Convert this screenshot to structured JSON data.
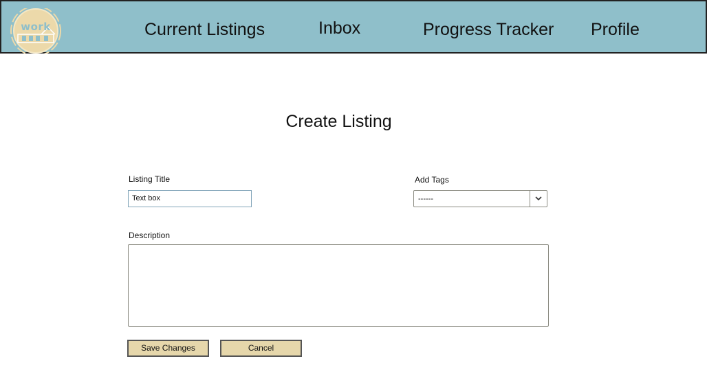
{
  "nav": {
    "logo_text": "work",
    "items": [
      {
        "label": "Current Listings"
      },
      {
        "label": "Inbox"
      },
      {
        "label": "Progress Tracker"
      },
      {
        "label": "Profile"
      }
    ]
  },
  "page": {
    "title": "Create Listing"
  },
  "form": {
    "listing_title": {
      "label": "Listing Title",
      "value": "Text box"
    },
    "tags": {
      "label": "Add Tags",
      "selected": "------"
    },
    "description": {
      "label": "Description",
      "value": ""
    }
  },
  "buttons": {
    "save_label": "Save Changes",
    "cancel_label": "Cancel"
  },
  "colors": {
    "navbar": "#8fbfca",
    "button": "#e6d7ab",
    "logo_circle": "#ecd9aa"
  },
  "icons": {
    "select_arrow": "chevron-down-icon",
    "logo": "house-logo-icon"
  }
}
